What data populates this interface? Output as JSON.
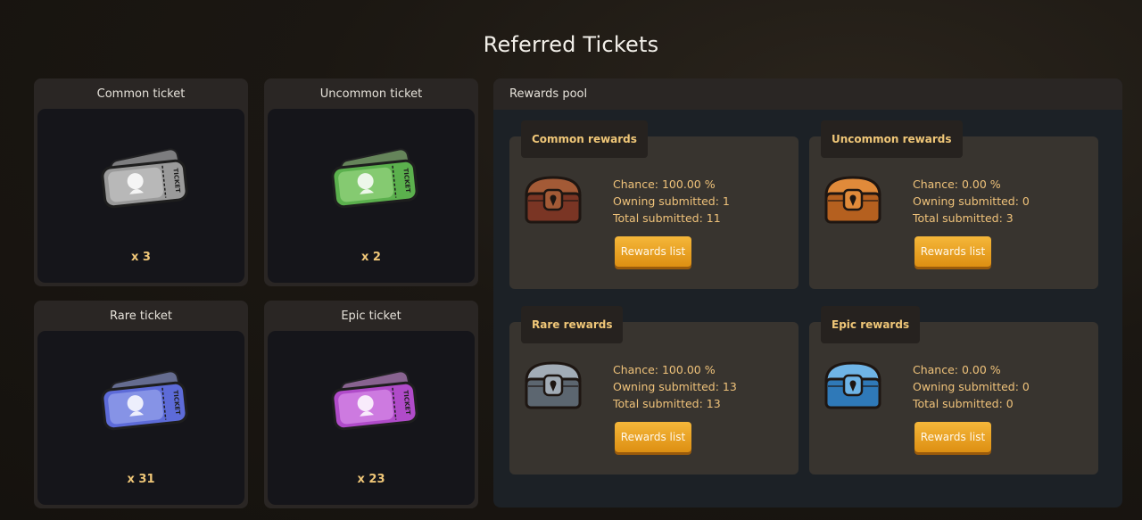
{
  "page": {
    "title": "Referred Tickets"
  },
  "tickets": [
    {
      "label": "Common ticket",
      "count": "x 3",
      "color": "#9a9a9a",
      "highlight": "#d2d2d2"
    },
    {
      "label": "Uncommon ticket",
      "count": "x 2",
      "color": "#5bb04d",
      "highlight": "#a7e08f"
    },
    {
      "label": "Rare ticket",
      "count": "x 31",
      "color": "#5d6bd8",
      "highlight": "#a8b4f2"
    },
    {
      "label": "Epic ticket",
      "count": "x 23",
      "color": "#b04bc9",
      "highlight": "#e6a3f2"
    }
  ],
  "ticket_stub_text": "TICKET",
  "pool": {
    "title": "Rewards pool",
    "rewards": [
      {
        "label": "Common rewards",
        "chance": "Chance: 100.00 %",
        "owning": "Owning submitted: 1",
        "total": "Total submitted: 11",
        "button": "Rewards list",
        "chest_color": "#7a3524",
        "chest_trim": "#a35a36"
      },
      {
        "label": "Uncommon rewards",
        "chance": "Chance: 0.00 %",
        "owning": "Owning submitted: 0",
        "total": "Total submitted: 3",
        "button": "Rewards list",
        "chest_color": "#b5601f",
        "chest_trim": "#e08a3a"
      },
      {
        "label": "Rare rewards",
        "chance": "Chance: 100.00 %",
        "owning": "Owning submitted: 13",
        "total": "Total submitted: 13",
        "button": "Rewards list",
        "chest_color": "#5c6670",
        "chest_trim": "#a2acb6"
      },
      {
        "label": "Epic rewards",
        "chance": "Chance: 0.00 %",
        "owning": "Owning submitted: 0",
        "total": "Total submitted: 0",
        "button": "Rewards list",
        "chest_color": "#2f79b8",
        "chest_trim": "#6fb4e6"
      }
    ]
  }
}
